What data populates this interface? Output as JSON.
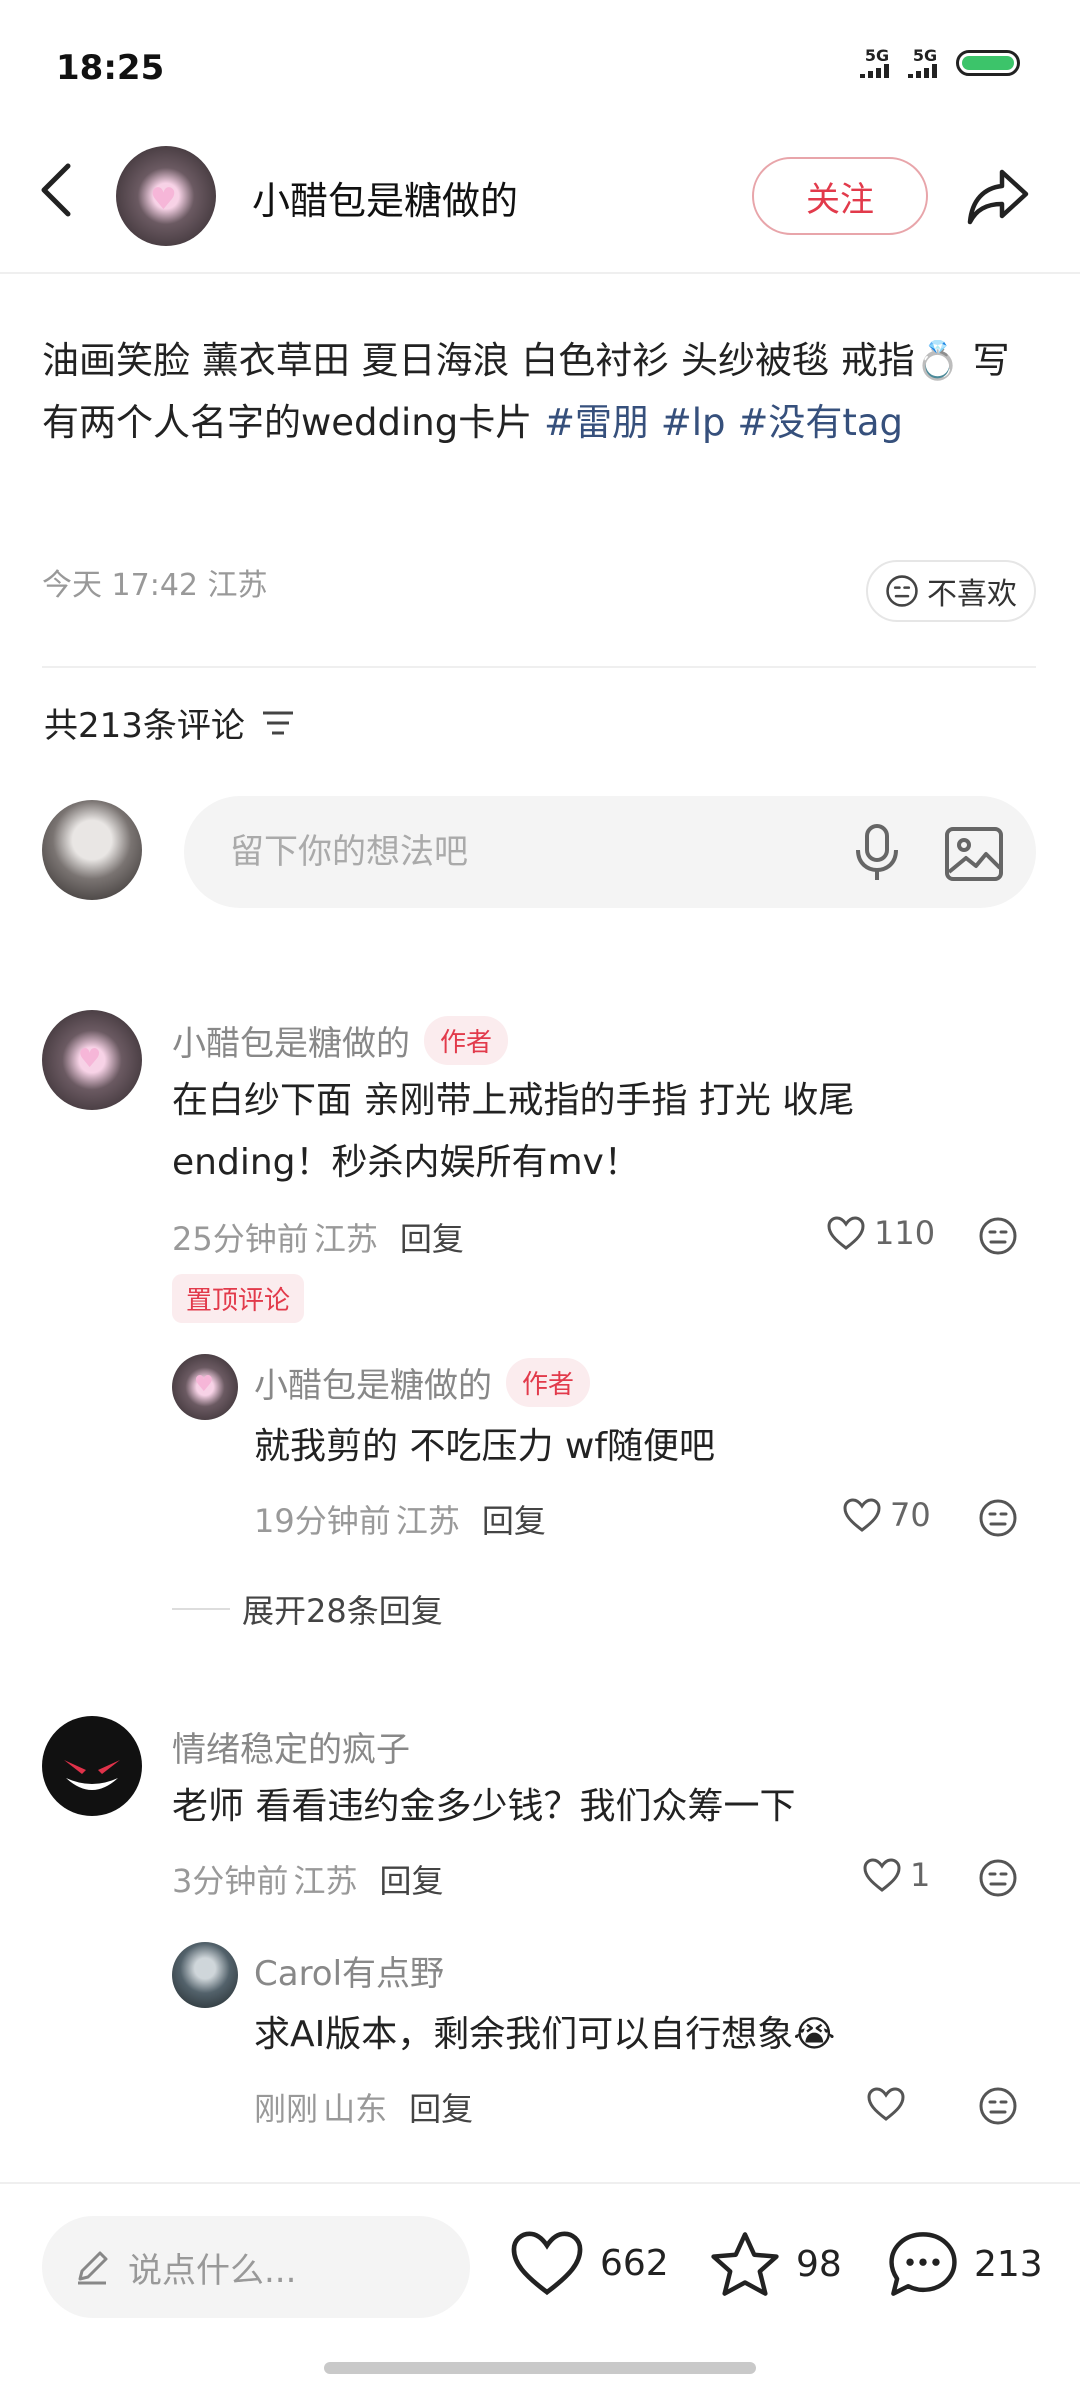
{
  "status_bar": {
    "time": "18:25",
    "signal1": "5G",
    "signal2": "5G"
  },
  "header": {
    "author": "小醋包是糖做的",
    "follow_label": "关注"
  },
  "post": {
    "text_plain": "油画笑脸 薰衣草田 夏日海浪 白色衬衫 头纱被毯 戒指💍 写有两个人名字的wedding卡片 ",
    "tags": [
      "#雷朋",
      "#lp",
      "#没有tag"
    ],
    "time": "今天 17:42",
    "location": "江苏",
    "dislike_label": "不喜欢"
  },
  "comments_header": {
    "count_label": "共213条评论"
  },
  "comment_input": {
    "placeholder": "留下你的想法吧"
  },
  "comments": [
    {
      "name": "小醋包是糖做的",
      "badge": "作者",
      "text": "在白纱下面 亲刚带上戒指的手指 打光 收尾ending！秒杀内娱所有mv！",
      "time": "25分钟前",
      "location": "江苏",
      "reply_label": "回复",
      "likes": "110",
      "pinned_label": "置顶评论",
      "replies": [
        {
          "name": "小醋包是糖做的",
          "badge": "作者",
          "text": "就我剪的 不吃压力 wf随便吧",
          "time": "19分钟前",
          "location": "江苏",
          "reply_label": "回复",
          "likes": "70"
        }
      ],
      "expand_label": "展开28条回复"
    },
    {
      "name": "情绪稳定的疯子",
      "text": "老师 看看违约金多少钱？我们众筹一下",
      "time": "3分钟前",
      "location": "江苏",
      "reply_label": "回复",
      "likes": "1",
      "replies": [
        {
          "name": "Carol有点野",
          "text": "求AI版本，剩余我们可以自行想象😭",
          "time": "刚刚",
          "location": "山东",
          "reply_label": "回复",
          "likes": ""
        }
      ]
    }
  ],
  "bottom_bar": {
    "input_placeholder": "说点什么...",
    "likes": "662",
    "favorites": "98",
    "comments": "213"
  }
}
